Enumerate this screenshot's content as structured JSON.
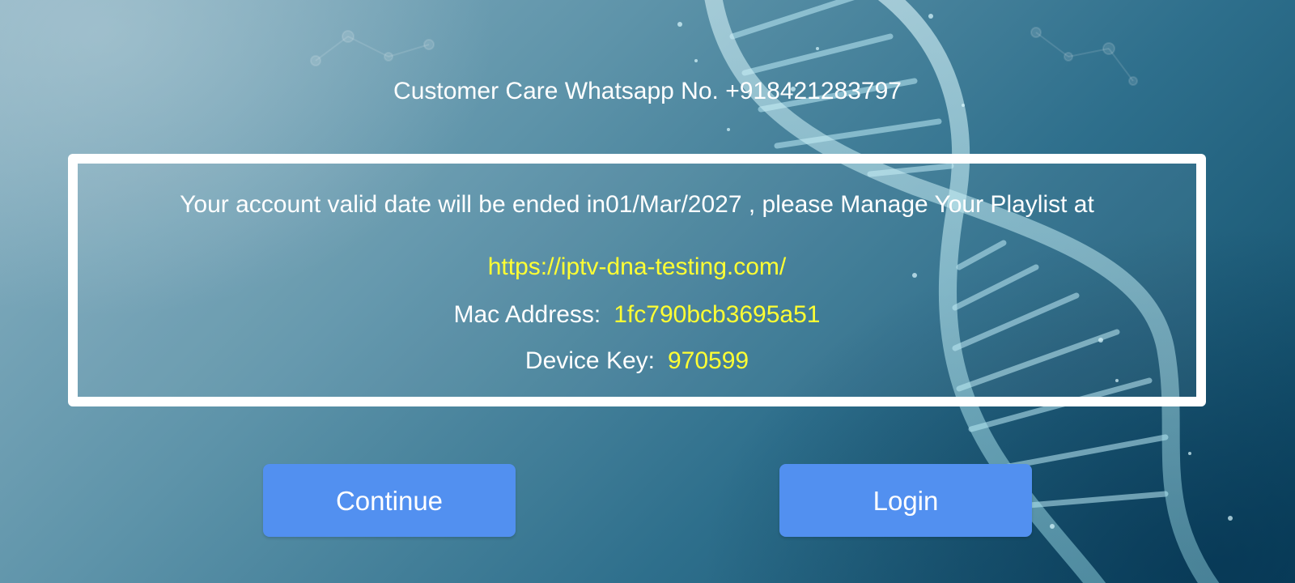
{
  "theme": {
    "accent": "#5290f0",
    "highlight": "#ffff33",
    "text": "#ffffff"
  },
  "header": {
    "customer_care": "Customer Care Whatsapp No. +918421283797"
  },
  "account": {
    "validity_message": "Your account valid date will be ended in01/Mar/2027 , please Manage Your Playlist at",
    "portal_url": "https://iptv-dna-testing.com/",
    "mac_label": "Mac Address:",
    "mac_value": "1fc790bcb3695a51",
    "device_key_label": "Device Key:",
    "device_key_value": "970599"
  },
  "actions": {
    "continue_label": "Continue",
    "login_label": "Login"
  },
  "background": {
    "illustration": "dna-helix"
  }
}
